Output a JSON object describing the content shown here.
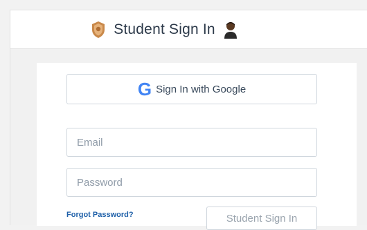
{
  "header": {
    "title": "Student Sign In",
    "left_icon": "shield-badge-icon",
    "right_icon": "student-avatar-icon"
  },
  "form": {
    "google_button_label": "Sign In with Google",
    "google_glyph": "G",
    "email_placeholder": "Email",
    "password_placeholder": "Password",
    "forgot_link": "Forgot Password?",
    "submit_label": "Student Sign In"
  },
  "colors": {
    "link": "#1d5fa8",
    "google_blue": "#4285F4",
    "google_red": "#EA4335",
    "google_yellow": "#FBBC05",
    "google_green": "#34A853"
  }
}
